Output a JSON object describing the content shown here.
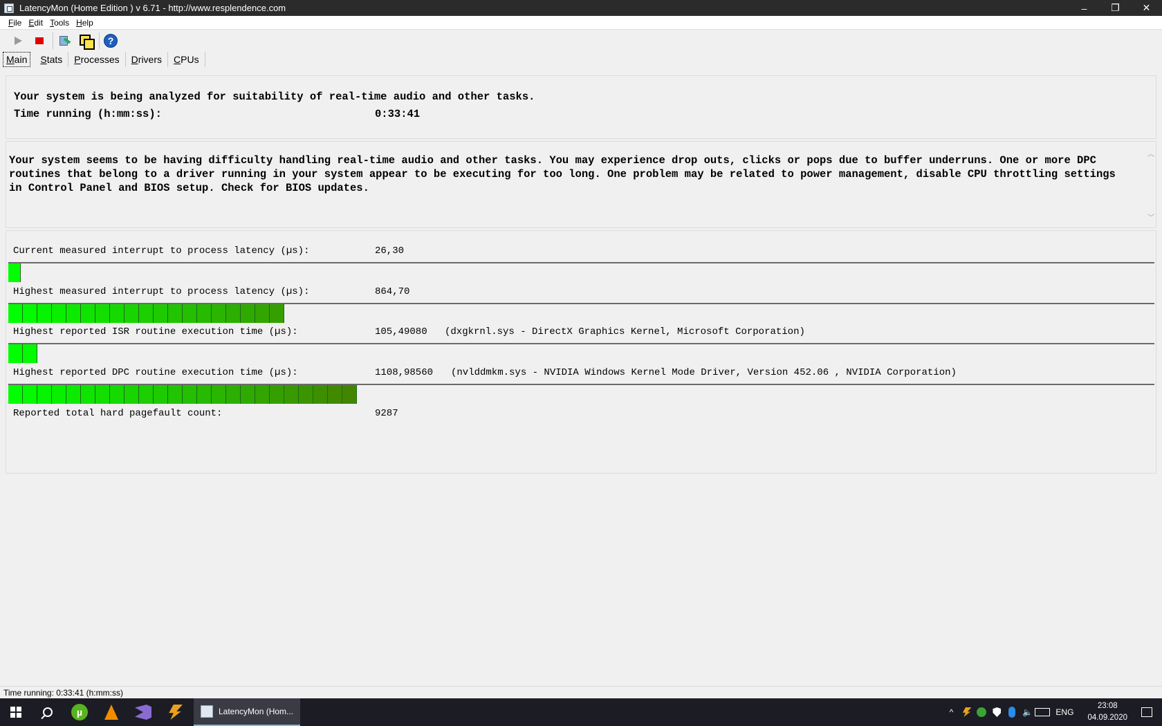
{
  "window": {
    "title": "LatencyMon  (Home Edition )  v 6.71 - http://www.resplendence.com",
    "controls": {
      "minimize": "–",
      "restore": "❐",
      "close": "✕"
    }
  },
  "menu": [
    "File",
    "Edit",
    "Tools",
    "Help"
  ],
  "toolbar": {
    "buttons": [
      "play-icon",
      "stop-icon",
      "report-icon",
      "copy-icon",
      "help-icon"
    ],
    "help_label": "?"
  },
  "tabs": [
    "Main",
    "Stats",
    "Processes",
    "Drivers",
    "CPUs"
  ],
  "main": {
    "analyzing_text": "Your system is being analyzed for suitability of real-time audio and other tasks.",
    "time_running_label": "Time running (h:mm:ss):",
    "time_running_value": "0:33:41",
    "message": "Your system seems to be having difficulty handling real-time audio and other tasks. You may experience drop outs, clicks or pops due to buffer underruns. One or more DPC routines that belong to a driver running in your system appear to be executing for too long. One problem may be related to power management, disable CPU throttling settings in Control Panel and BIOS setup. Check for BIOS updates.",
    "metrics": [
      {
        "label": "Current measured interrupt to process latency (µs):",
        "value": "26,30",
        "extra": "",
        "bar_segments": 1
      },
      {
        "label": "Highest measured interrupt to process latency (µs):",
        "value": "864,70",
        "extra": "",
        "bar_segments": 19
      },
      {
        "label": "Highest reported ISR routine execution time (µs):",
        "value": "105,49080",
        "extra": "(dxgkrnl.sys - DirectX Graphics Kernel, Microsoft Corporation)",
        "bar_segments": 2
      },
      {
        "label": "Highest reported DPC routine execution time (µs):",
        "value": "1108,98560",
        "extra": "(nvlddmkm.sys - NVIDIA Windows Kernel Mode Driver, Version 452.06 , NVIDIA Corporation)",
        "bar_segments": 24
      }
    ],
    "pagefault_label": "Reported total hard pagefault count:",
    "pagefault_value": "9287"
  },
  "statusbar": {
    "text": "Time running: 0:33:41  (h:mm:ss)"
  },
  "taskbar": {
    "active_task": "LatencyMon  (Hom...",
    "utorrent_label": "µ",
    "tray": {
      "chevron": "^",
      "volume": "🔈",
      "language": "ENG",
      "time": "23:08",
      "date": "04.09.2020"
    }
  },
  "colors": {
    "bar_start": "#00ff00",
    "bar_end": "#4a7a00",
    "titlebar": "#2b2b2b",
    "stop": "#e00000"
  }
}
